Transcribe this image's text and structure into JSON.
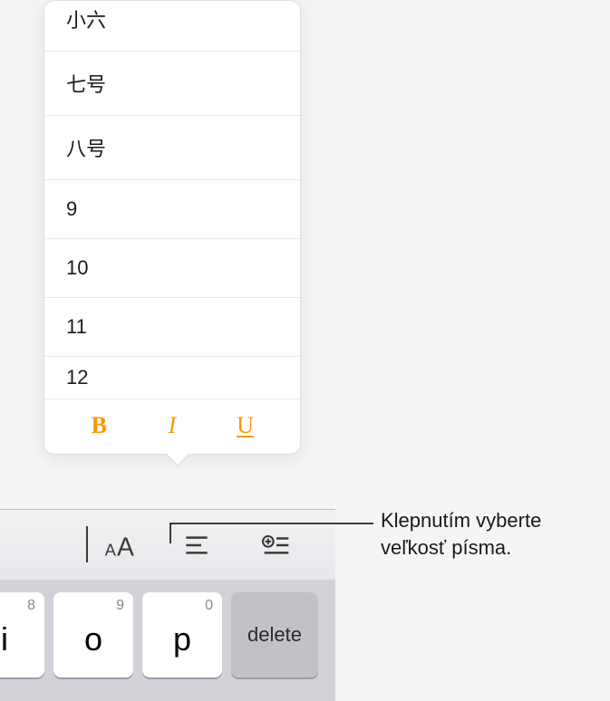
{
  "popover": {
    "sizes": [
      "小六",
      "七号",
      "八号",
      "9",
      "10",
      "11",
      "12"
    ],
    "bold": "B",
    "italic": "I",
    "underline": "U"
  },
  "keyboard": {
    "keys": [
      {
        "hint": "8",
        "main": "i"
      },
      {
        "hint": "9",
        "main": "o"
      },
      {
        "hint": "0",
        "main": "p"
      }
    ],
    "delete": "delete"
  },
  "callout": {
    "line1": "Klepnutím vyberte",
    "line2": "veľkosť písma."
  }
}
